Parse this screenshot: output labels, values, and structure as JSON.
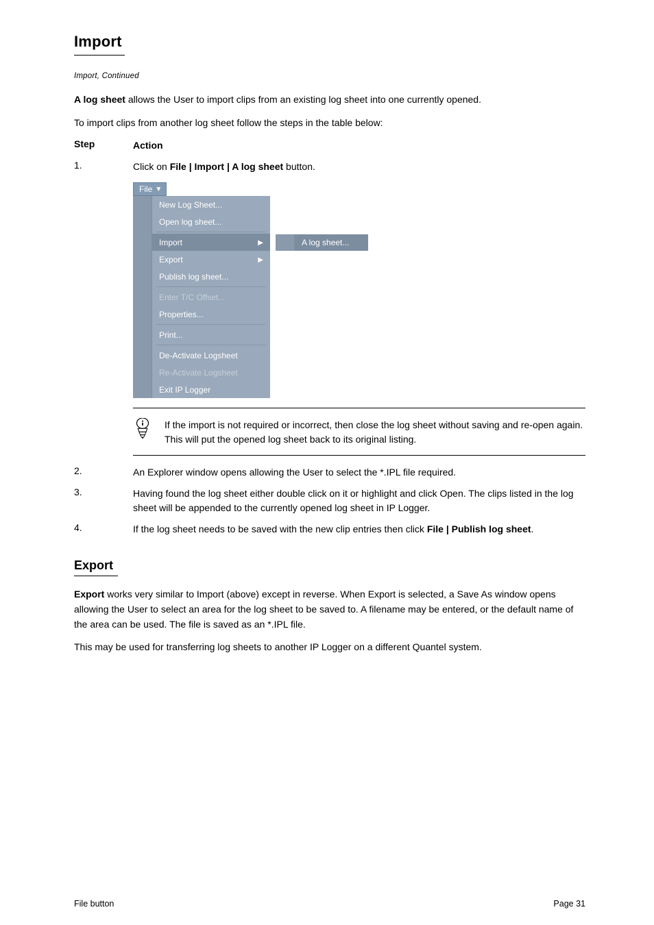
{
  "section_title": "Import",
  "continued_note": "Import, Continued",
  "intro_lead": "A log sheet",
  "intro_after": " allows the User to import clips from an existing log sheet into one currently opened.",
  "intro_para2": "To import clips from another log sheet follow the steps in the table below:",
  "steps": {
    "col_step": "Step",
    "col_action": "Action",
    "s1_num": "1.",
    "s1_text_a": "Click on ",
    "s1_text_b": "File | Import | A log sheet",
    "s1_text_c": " button.",
    "s2_num": "2.",
    "s2_text": "An Explorer window opens allowing the User to select the *.IPL file required.",
    "s3_num": "3.",
    "s3_text": "Having found the log sheet either double click on it or highlight and click Open. The clips listed in the log sheet will be appended to the currently opened log sheet in IP Logger.",
    "s4_num": "4.",
    "s4_text_a": "If the log sheet needs to be saved with the new clip entries then click ",
    "s4_text_b": "File | Publish log sheet",
    "s4_text_c": "."
  },
  "menu": {
    "file_label": "File",
    "items": {
      "new": "New Log Sheet...",
      "open": "Open log sheet...",
      "import": "Import",
      "export": "Export",
      "publish": "Publish log sheet...",
      "tc": "Enter T/C Offset...",
      "props": "Properties...",
      "print": "Print...",
      "deact": "De-Activate Logsheet",
      "react": "Re-Activate Logsheet",
      "exit": "Exit IP Logger"
    },
    "submenu_item": "A log sheet..."
  },
  "note_text": "If the import is not required or incorrect, then close the log sheet without saving and re-open again. This will put the opened log sheet back to its original listing.",
  "export": {
    "title": "Export",
    "para1_a": "Export",
    "para1_b": " works very similar to Import (above) except in reverse. When Export is selected, a Save As window opens allowing the User to select an area for the log sheet to be saved to. A filename may be entered, or the default name of the area can be used. The file is saved as an *.IPL file.",
    "para2": "This may be used for transferring log sheets to another IP Logger on a different Quantel system."
  },
  "footer_left": "File button",
  "footer_right": "Page 31"
}
